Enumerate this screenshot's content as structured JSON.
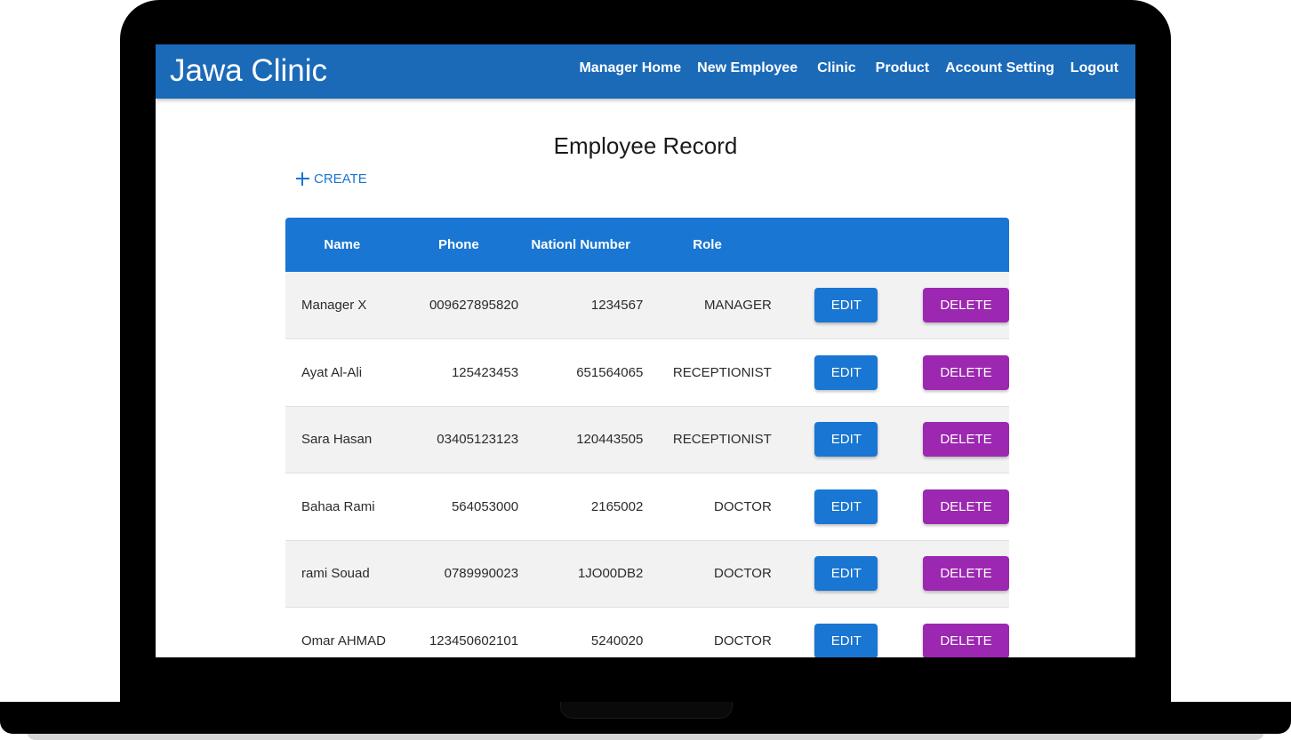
{
  "app": {
    "title": "Jawa Clinic"
  },
  "nav": {
    "items": [
      "Manager Home",
      "New Employee",
      "Clinic",
      "Product",
      "Account Setting",
      "Logout"
    ]
  },
  "page": {
    "title": "Employee Record",
    "create_label": "CREATE"
  },
  "table": {
    "headers": [
      "Name",
      "Phone",
      "Nationl Number",
      "Role"
    ],
    "edit_label": "EDIT",
    "delete_label": "DELETE",
    "rows": [
      {
        "name": "Manager X",
        "phone": "009627895820",
        "national": "1234567",
        "role": "MANAGER"
      },
      {
        "name": "Ayat Al-Ali",
        "phone": "125423453",
        "national": "651564065",
        "role": "RECEPTIONIST"
      },
      {
        "name": "Sara Hasan",
        "phone": "03405123123",
        "national": "120443505",
        "role": "RECEPTIONIST"
      },
      {
        "name": "Bahaa Rami",
        "phone": "564053000",
        "national": "2165002",
        "role": "DOCTOR"
      },
      {
        "name": "rami Souad",
        "phone": "0789990023",
        "national": "1JO00DB2",
        "role": "DOCTOR"
      },
      {
        "name": "Omar AHMAD",
        "phone": "123450602101",
        "national": "5240020",
        "role": "DOCTOR"
      }
    ]
  },
  "colors": {
    "appbar": "#1b6ab8",
    "primary": "#1976d2",
    "delete": "#9c27b0"
  }
}
